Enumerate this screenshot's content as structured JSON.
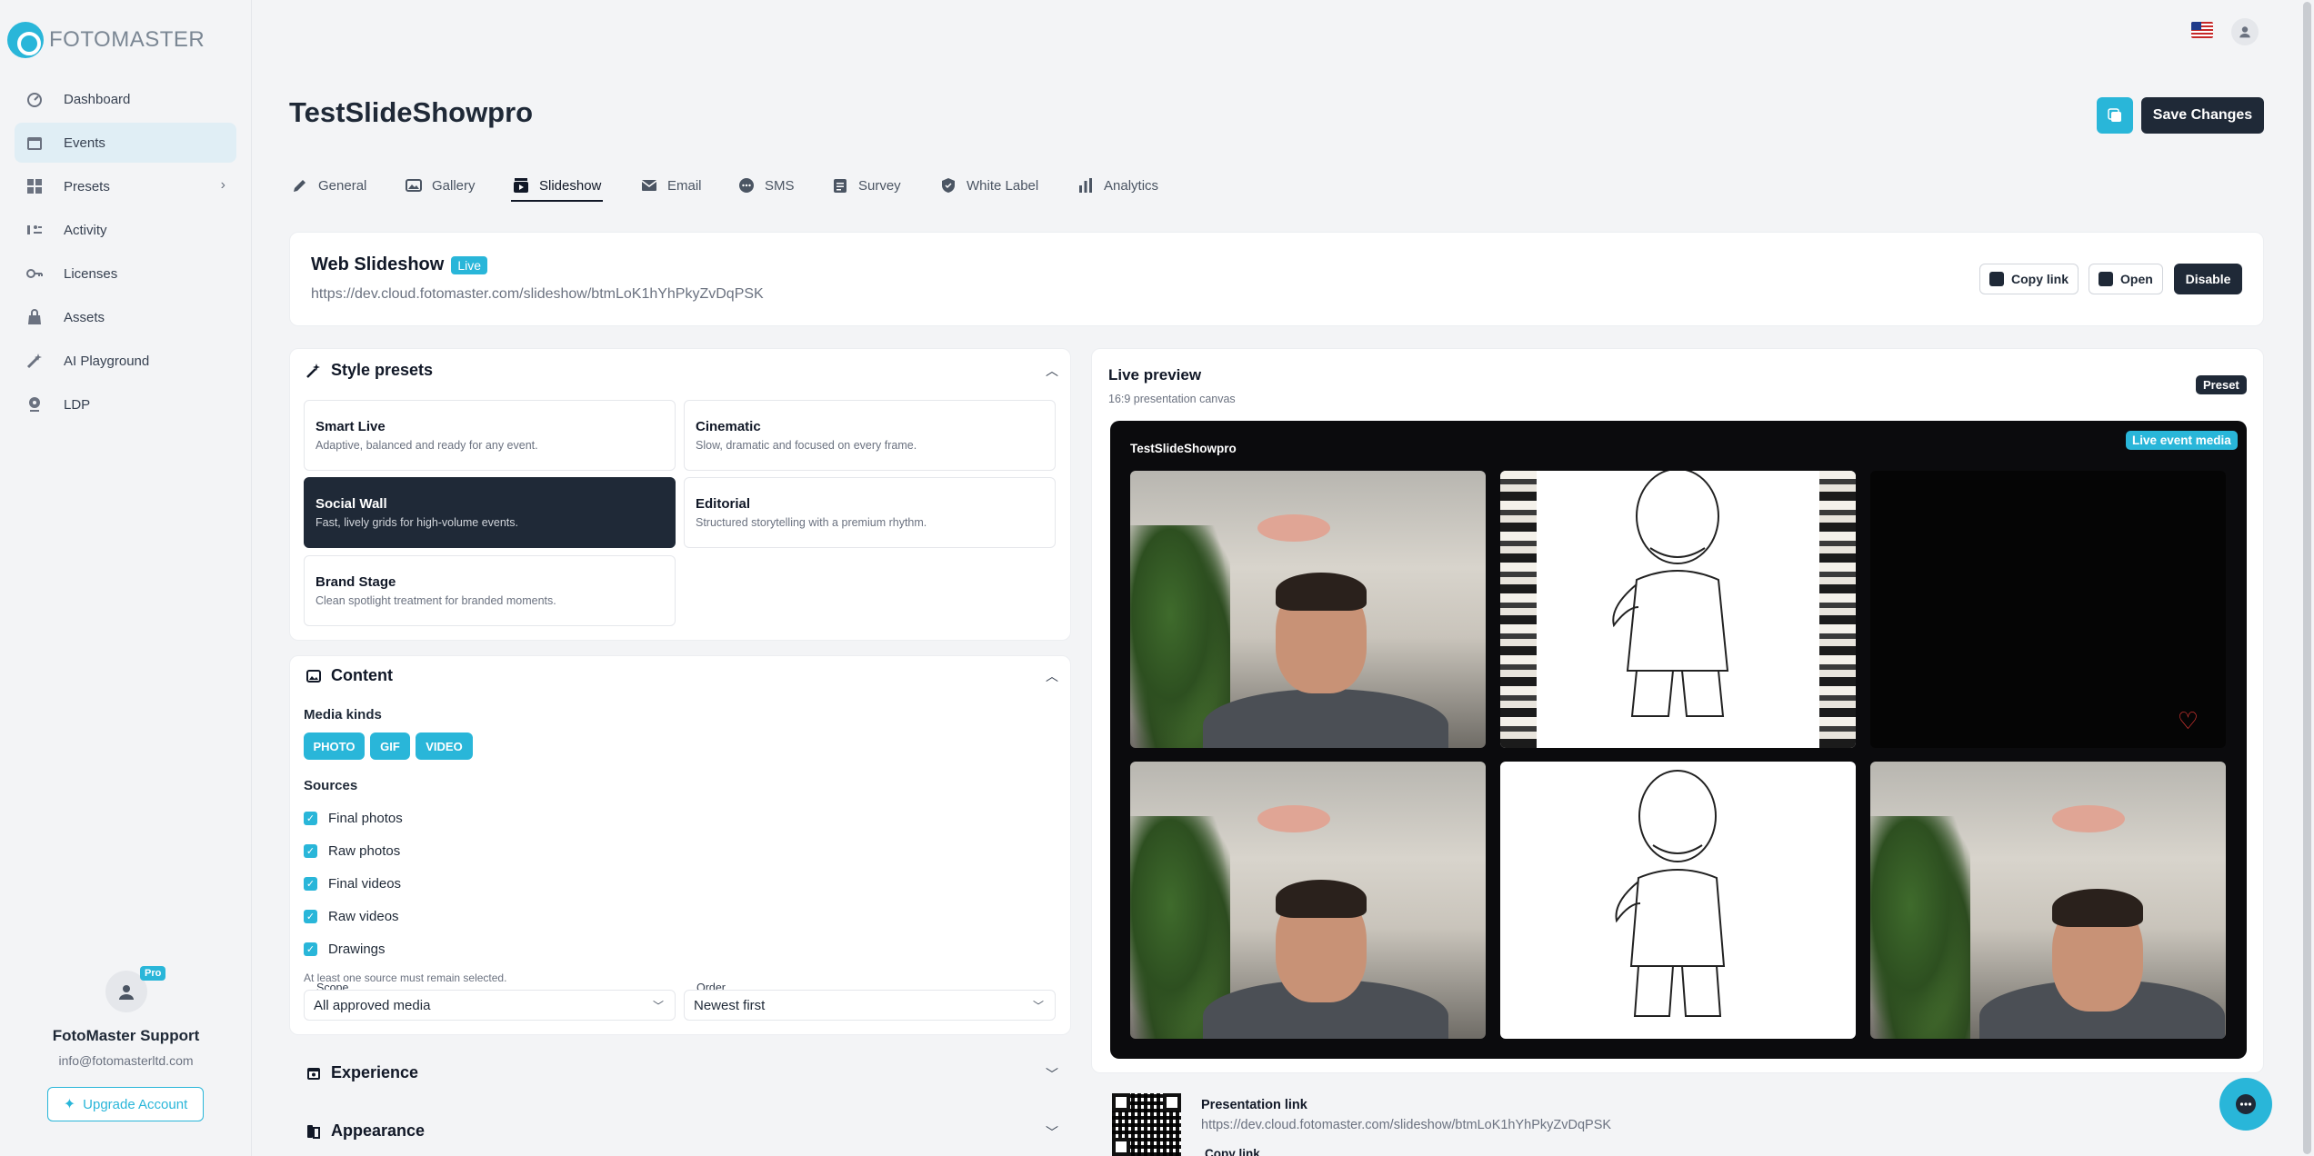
{
  "brand": {
    "logo_text": "FOTOMASTER"
  },
  "sidebar": {
    "items": [
      {
        "label": "Dashboard",
        "icon": "dashboard-icon"
      },
      {
        "label": "Events",
        "icon": "calendar-icon"
      },
      {
        "label": "Presets",
        "icon": "grid-icon"
      },
      {
        "label": "Activity",
        "icon": "activity-icon"
      },
      {
        "label": "Licenses",
        "icon": "key-icon"
      },
      {
        "label": "Assets",
        "icon": "bag-icon"
      },
      {
        "label": "AI Playground",
        "icon": "wand-icon"
      },
      {
        "label": "LDP",
        "icon": "pin-icon"
      }
    ],
    "user": {
      "name": "FotoMaster Support",
      "email": "info@fotomasterltd.com",
      "badge": "Pro"
    },
    "upgrade_label": "Upgrade Account"
  },
  "header": {
    "title": "TestSlideShowpro",
    "save_label": "Save Changes"
  },
  "tabs": [
    "General",
    "Gallery",
    "Slideshow",
    "Email",
    "SMS",
    "Survey",
    "White Label",
    "Analytics"
  ],
  "web_slideshow": {
    "title": "Web Slideshow",
    "badge": "Live",
    "url": "https://dev.cloud.fotomaster.com/slideshow/btmLoK1hYhPkyZvDqPSK",
    "copy_label": "Copy link",
    "open_label": "Open",
    "disable_label": "Disable"
  },
  "style_presets": {
    "title": "Style presets",
    "items": [
      {
        "name": "Smart Live",
        "desc": "Adaptive, balanced and ready for any event."
      },
      {
        "name": "Cinematic",
        "desc": "Slow, dramatic and focused on every frame."
      },
      {
        "name": "Social Wall",
        "desc": "Fast, lively grids for high-volume events."
      },
      {
        "name": "Editorial",
        "desc": "Structured storytelling with a premium rhythm."
      },
      {
        "name": "Brand Stage",
        "desc": "Clean spotlight treatment for branded moments."
      }
    ]
  },
  "content": {
    "title": "Content",
    "media_kinds_label": "Media kinds",
    "media_kinds": [
      "PHOTO",
      "GIF",
      "VIDEO"
    ],
    "sources_label": "Sources",
    "sources": [
      "Final photos",
      "Raw photos",
      "Final videos",
      "Raw videos",
      "Drawings"
    ],
    "hint": "At least one source must remain selected.",
    "scope_label": "Scope",
    "scope_value": "All approved media",
    "order_label": "Order",
    "order_value": "Newest first"
  },
  "experience": {
    "title": "Experience"
  },
  "appearance": {
    "title": "Appearance"
  },
  "preview": {
    "title": "Live preview",
    "subtitle": "16:9 presentation canvas",
    "preset_badge": "Preset",
    "canvas_title": "TestSlideShowpro",
    "live_badge": "Live event media"
  },
  "presentation": {
    "label": "Presentation link",
    "url": "https://dev.cloud.fotomaster.com/slideshow/btmLoK1hYhPkyZvDqPSK",
    "copy_label": "Copy link"
  }
}
